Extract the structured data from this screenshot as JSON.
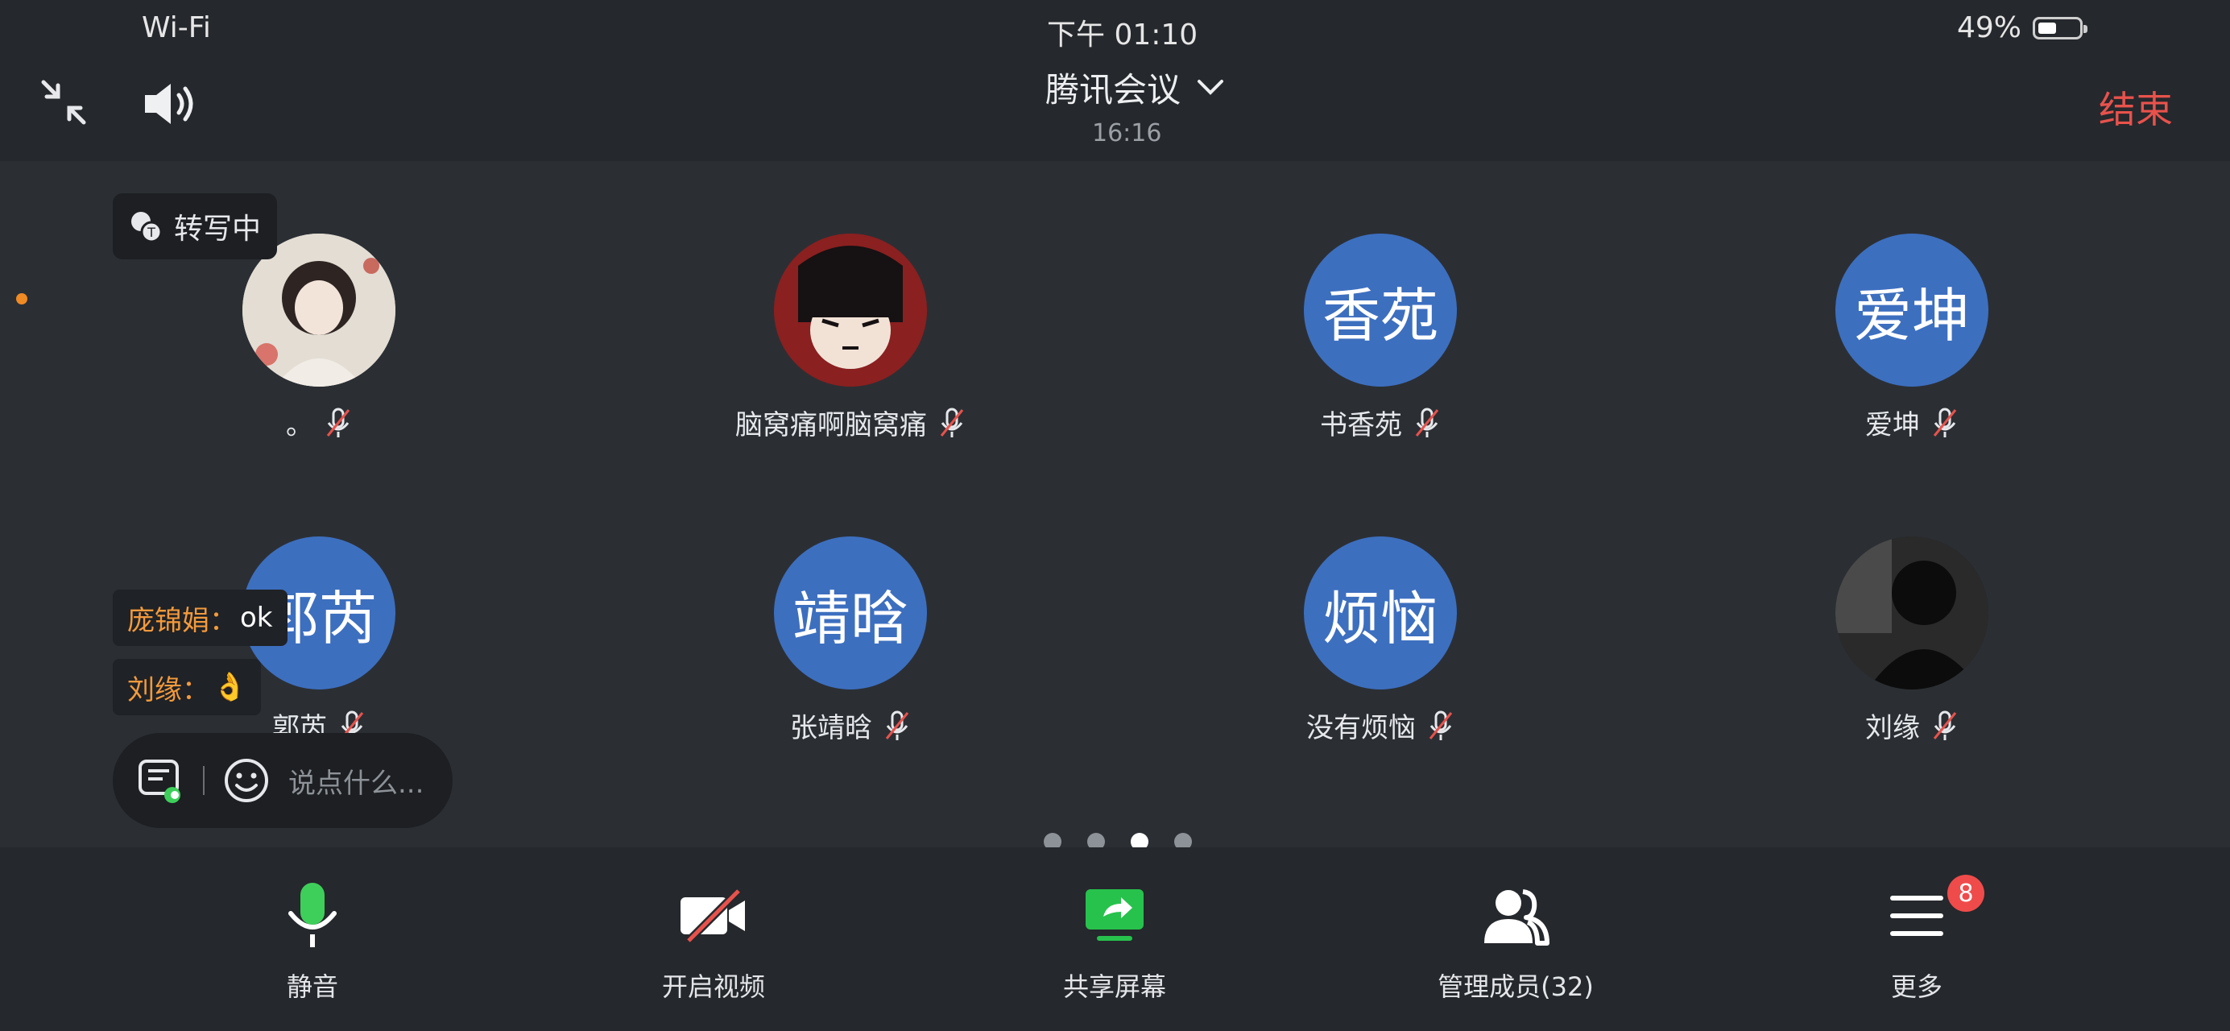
{
  "status": {
    "network": "Wi-Fi",
    "time": "下午 01:10",
    "battery": "49%"
  },
  "header": {
    "title": "腾讯会议",
    "duration": "16:16",
    "end_label": "结束"
  },
  "transcribe": {
    "label": "转写中"
  },
  "participants": [
    {
      "name": "。",
      "avatar_text": ""
    },
    {
      "name": "脑窝痛啊脑窝痛",
      "avatar_text": ""
    },
    {
      "name": "书香苑",
      "avatar_text": "香苑"
    },
    {
      "name": "爱坤",
      "avatar_text": "爱坤"
    },
    {
      "name": "郭芮",
      "avatar_text": "郭芮"
    },
    {
      "name": "张靖晗",
      "avatar_text": "靖晗"
    },
    {
      "name": "没有烦恼",
      "avatar_text": "烦恼"
    },
    {
      "name": "刘缘",
      "avatar_text": ""
    }
  ],
  "chat": {
    "messages": [
      {
        "sender": "庞锦娟：",
        "text": "ok"
      },
      {
        "sender": "刘缘：",
        "text": "👌"
      }
    ],
    "placeholder": "说点什么..."
  },
  "pager": {
    "count": 4,
    "active_index": 2
  },
  "toolbar": {
    "mute_label": "静音",
    "video_label": "开启视频",
    "share_label": "共享屏幕",
    "members_label": "管理成员(32)",
    "more_label": "更多",
    "more_badge": "8"
  },
  "colors": {
    "avatar_blue": "#3d6fbf",
    "end_red": "#e8524c",
    "sender_orange": "#f39a3c",
    "mic_green": "#3ecf5a",
    "share_green": "#27c24c",
    "badge_red": "#f04b4b"
  }
}
